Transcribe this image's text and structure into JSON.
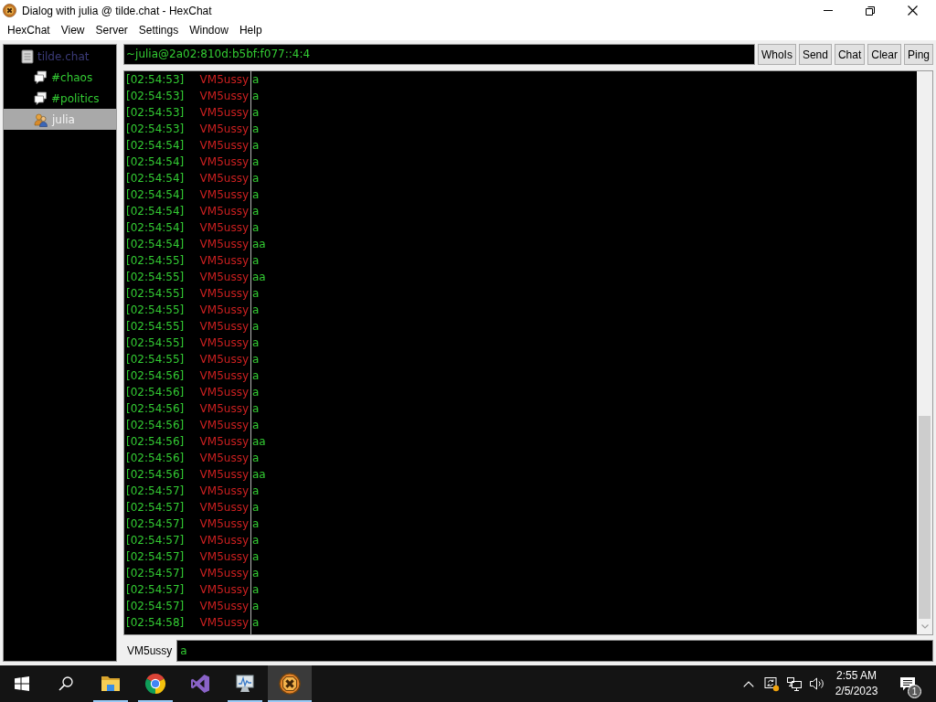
{
  "window": {
    "title": "Dialog with julia @ tilde.chat - HexChat"
  },
  "menu": [
    "HexChat",
    "View",
    "Server",
    "Settings",
    "Window",
    "Help"
  ],
  "sidebar": {
    "items": [
      {
        "label": "tilde.chat",
        "kind": "server",
        "selected": false,
        "children": [
          {
            "label": "#chaos",
            "kind": "channel",
            "selected": false
          },
          {
            "label": "#politics",
            "kind": "channel",
            "selected": false
          },
          {
            "label": "julia",
            "kind": "dialog",
            "selected": true
          }
        ]
      }
    ]
  },
  "topic": "~julia@2a02:810d:b5bf:f077::4:4",
  "buttons": [
    "WhoIs",
    "Send",
    "Chat",
    "Clear",
    "Ping"
  ],
  "messages": [
    {
      "time": "[02:54:53]",
      "nick": "VM5ussy",
      "text": "a"
    },
    {
      "time": "[02:54:53]",
      "nick": "VM5ussy",
      "text": "a"
    },
    {
      "time": "[02:54:53]",
      "nick": "VM5ussy",
      "text": "a"
    },
    {
      "time": "[02:54:53]",
      "nick": "VM5ussy",
      "text": "a"
    },
    {
      "time": "[02:54:54]",
      "nick": "VM5ussy",
      "text": "a"
    },
    {
      "time": "[02:54:54]",
      "nick": "VM5ussy",
      "text": "a"
    },
    {
      "time": "[02:54:54]",
      "nick": "VM5ussy",
      "text": "a"
    },
    {
      "time": "[02:54:54]",
      "nick": "VM5ussy",
      "text": "a"
    },
    {
      "time": "[02:54:54]",
      "nick": "VM5ussy",
      "text": "a"
    },
    {
      "time": "[02:54:54]",
      "nick": "VM5ussy",
      "text": "a"
    },
    {
      "time": "[02:54:54]",
      "nick": "VM5ussy",
      "text": "aa"
    },
    {
      "time": "[02:54:55]",
      "nick": "VM5ussy",
      "text": "a"
    },
    {
      "time": "[02:54:55]",
      "nick": "VM5ussy",
      "text": "aa"
    },
    {
      "time": "[02:54:55]",
      "nick": "VM5ussy",
      "text": "a"
    },
    {
      "time": "[02:54:55]",
      "nick": "VM5ussy",
      "text": "a"
    },
    {
      "time": "[02:54:55]",
      "nick": "VM5ussy",
      "text": "a"
    },
    {
      "time": "[02:54:55]",
      "nick": "VM5ussy",
      "text": "a"
    },
    {
      "time": "[02:54:55]",
      "nick": "VM5ussy",
      "text": "a"
    },
    {
      "time": "[02:54:56]",
      "nick": "VM5ussy",
      "text": "a"
    },
    {
      "time": "[02:54:56]",
      "nick": "VM5ussy",
      "text": "a"
    },
    {
      "time": "[02:54:56]",
      "nick": "VM5ussy",
      "text": "a"
    },
    {
      "time": "[02:54:56]",
      "nick": "VM5ussy",
      "text": "a"
    },
    {
      "time": "[02:54:56]",
      "nick": "VM5ussy",
      "text": "aa"
    },
    {
      "time": "[02:54:56]",
      "nick": "VM5ussy",
      "text": "a"
    },
    {
      "time": "[02:54:56]",
      "nick": "VM5ussy",
      "text": "aa"
    },
    {
      "time": "[02:54:57]",
      "nick": "VM5ussy",
      "text": "a"
    },
    {
      "time": "[02:54:57]",
      "nick": "VM5ussy",
      "text": "a"
    },
    {
      "time": "[02:54:57]",
      "nick": "VM5ussy",
      "text": "a"
    },
    {
      "time": "[02:54:57]",
      "nick": "VM5ussy",
      "text": "a"
    },
    {
      "time": "[02:54:57]",
      "nick": "VM5ussy",
      "text": "a"
    },
    {
      "time": "[02:54:57]",
      "nick": "VM5ussy",
      "text": "a"
    },
    {
      "time": "[02:54:57]",
      "nick": "VM5ussy",
      "text": "a"
    },
    {
      "time": "[02:54:57]",
      "nick": "VM5ussy",
      "text": "a"
    },
    {
      "time": "[02:54:58]",
      "nick": "VM5ussy",
      "text": "a"
    }
  ],
  "input": {
    "nick": "VM5ussy",
    "value": "a"
  },
  "taskbar": {
    "apps": [
      {
        "kind": "folder",
        "running": true,
        "selected": false
      },
      {
        "kind": "browser",
        "running": true,
        "selected": false
      },
      {
        "kind": "ribbon",
        "running": false,
        "selected": false
      },
      {
        "kind": "monitor",
        "running": true,
        "selected": false
      },
      {
        "kind": "hexchat",
        "running": true,
        "selected": true
      }
    ],
    "tray": {
      "time": "2:55 AM",
      "date": "2/5/2023",
      "notifications": "1"
    }
  }
}
